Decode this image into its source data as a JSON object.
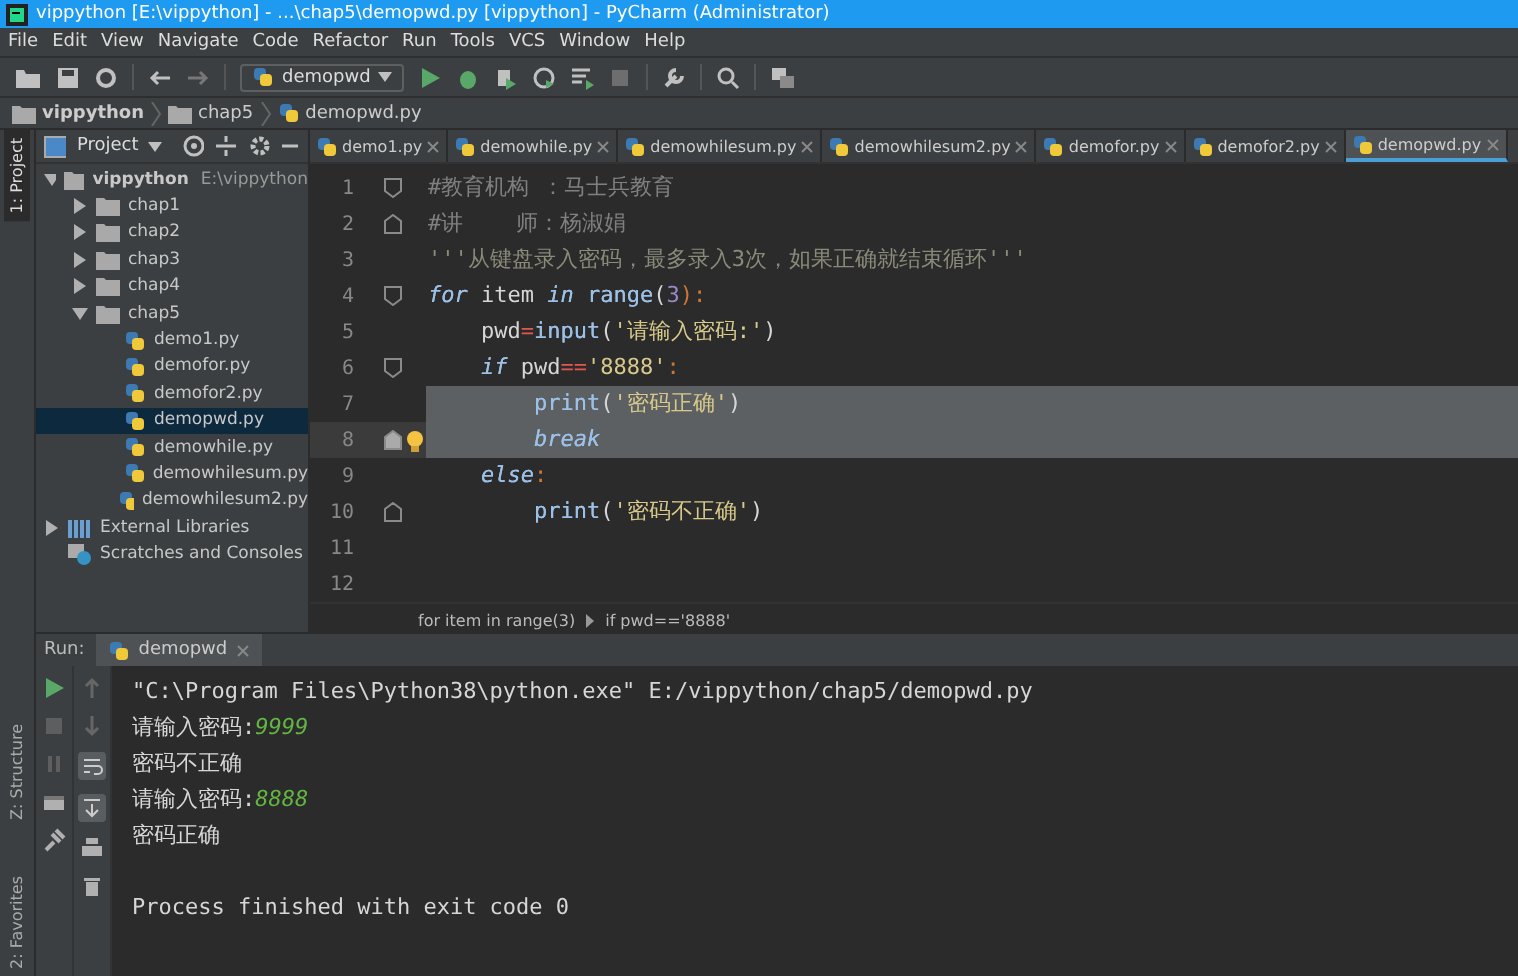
{
  "window": {
    "title": "vippython [E:\\vippython] - ...\\chap5\\demopwd.py [vippython] - PyCharm (Administrator)"
  },
  "menu": [
    "File",
    "Edit",
    "View",
    "Navigate",
    "Code",
    "Refactor",
    "Run",
    "Tools",
    "VCS",
    "Window",
    "Help"
  ],
  "toolbar": {
    "run_config": "demopwd"
  },
  "nav_bar": [
    "vippython",
    "chap5",
    "demopwd.py"
  ],
  "side_stripe": {
    "top": [
      {
        "label": "1: Project",
        "selected": true
      }
    ],
    "bottom": [
      {
        "label": "Z: Structure",
        "selected": false
      },
      {
        "label": "2: Favorites",
        "selected": false
      }
    ]
  },
  "project_panel": {
    "title": "Project",
    "tree": [
      {
        "label": "vippython",
        "path": "E:\\vippython",
        "kind": "root",
        "expanded": true,
        "selected": false,
        "children": [
          {
            "label": "chap1",
            "kind": "folder",
            "expanded": false,
            "selected": false
          },
          {
            "label": "chap2",
            "kind": "folder",
            "expanded": false,
            "selected": false
          },
          {
            "label": "chap3",
            "kind": "folder",
            "expanded": false,
            "selected": false
          },
          {
            "label": "chap4",
            "kind": "folder",
            "expanded": false,
            "selected": false
          },
          {
            "label": "chap5",
            "kind": "folder",
            "expanded": true,
            "selected": false,
            "children": [
              {
                "label": "demo1.py",
                "kind": "file",
                "selected": false
              },
              {
                "label": "demofor.py",
                "kind": "file",
                "selected": false
              },
              {
                "label": "demofor2.py",
                "kind": "file",
                "selected": false
              },
              {
                "label": "demopwd.py",
                "kind": "file",
                "selected": true
              },
              {
                "label": "demowhile.py",
                "kind": "file",
                "selected": false
              },
              {
                "label": "demowhilesum.py",
                "kind": "file",
                "selected": false
              },
              {
                "label": "demowhilesum2.py",
                "kind": "file",
                "selected": false
              }
            ]
          }
        ]
      },
      {
        "label": "External Libraries",
        "kind": "library",
        "expanded": false,
        "selected": false
      },
      {
        "label": "Scratches and Consoles",
        "kind": "scratches",
        "selected": false
      }
    ]
  },
  "editor_tabs": [
    {
      "label": "demo1.py",
      "selected": false
    },
    {
      "label": "demowhile.py",
      "selected": false
    },
    {
      "label": "demowhilesum.py",
      "selected": false
    },
    {
      "label": "demowhilesum2.py",
      "selected": false
    },
    {
      "label": "demofor.py",
      "selected": false
    },
    {
      "label": "demofor2.py",
      "selected": false
    },
    {
      "label": "demopwd.py",
      "selected": true
    }
  ],
  "code_lines": [
    {
      "number": "1",
      "fold_start": true,
      "fold_end": false,
      "selected": false,
      "current": false,
      "bulb": false,
      "tokens": [
        {
          "text": "#教育机构 ：马士兵教育",
          "kind": "comment"
        }
      ]
    },
    {
      "number": "2",
      "fold_start": false,
      "fold_end": true,
      "selected": false,
      "current": false,
      "bulb": false,
      "tokens": [
        {
          "text": "#讲    师：杨淑娟",
          "kind": "comment"
        }
      ]
    },
    {
      "number": "3",
      "fold_start": false,
      "fold_end": false,
      "selected": false,
      "current": false,
      "bulb": false,
      "tokens": [
        {
          "text": "'''从键盘录入密码，最多录入3次，如果正确就结束循环'''",
          "kind": "doc"
        }
      ]
    },
    {
      "number": "4",
      "fold_start": true,
      "fold_end": false,
      "selected": false,
      "current": false,
      "bulb": false,
      "tokens": [
        {
          "text": "for",
          "kind": "kw"
        },
        {
          "text": " item ",
          "kind": "text"
        },
        {
          "text": "in",
          "kind": "kw"
        },
        {
          "text": " range",
          "kind": "builtin"
        },
        {
          "text": "(",
          "kind": "text"
        },
        {
          "text": "3",
          "kind": "num"
        },
        {
          "text": "):",
          "kind": "punct"
        }
      ]
    },
    {
      "number": "5",
      "fold_start": false,
      "fold_end": false,
      "selected": false,
      "current": false,
      "bulb": false,
      "tokens": [
        {
          "text": "    pwd",
          "kind": "text"
        },
        {
          "text": "=",
          "kind": "op"
        },
        {
          "text": "input",
          "kind": "builtin"
        },
        {
          "text": "(",
          "kind": "text"
        },
        {
          "text": "'请输入密码:'",
          "kind": "str"
        },
        {
          "text": ")",
          "kind": "text"
        }
      ]
    },
    {
      "number": "6",
      "fold_start": true,
      "fold_end": false,
      "selected": false,
      "current": false,
      "bulb": false,
      "tokens": [
        {
          "text": "    if",
          "kind": "kw"
        },
        {
          "text": " pwd",
          "kind": "text"
        },
        {
          "text": "==",
          "kind": "op"
        },
        {
          "text": "'8888'",
          "kind": "str"
        },
        {
          "text": ":",
          "kind": "punct"
        }
      ]
    },
    {
      "number": "7",
      "fold_start": false,
      "fold_end": false,
      "selected": true,
      "current": false,
      "bulb": false,
      "tokens": [
        {
          "text": "        print",
          "kind": "builtin"
        },
        {
          "text": "(",
          "kind": "text"
        },
        {
          "text": "'密码正确'",
          "kind": "str"
        },
        {
          "text": ")",
          "kind": "text"
        }
      ]
    },
    {
      "number": "8",
      "fold_start": false,
      "fold_end": true,
      "selected": true,
      "current": true,
      "bulb": true,
      "tokens": [
        {
          "text": "        break",
          "kind": "kw"
        }
      ]
    },
    {
      "number": "9",
      "fold_start": false,
      "fold_end": false,
      "selected": false,
      "current": false,
      "bulb": false,
      "tokens": [
        {
          "text": "    else",
          "kind": "kw"
        },
        {
          "text": ":",
          "kind": "punct"
        }
      ]
    },
    {
      "number": "10",
      "fold_start": false,
      "fold_end": true,
      "selected": false,
      "current": false,
      "bulb": false,
      "tokens": [
        {
          "text": "        print",
          "kind": "builtin"
        },
        {
          "text": "(",
          "kind": "text"
        },
        {
          "text": "'密码不正确'",
          "kind": "str"
        },
        {
          "text": ")",
          "kind": "text"
        }
      ]
    },
    {
      "number": "11",
      "fold_start": false,
      "fold_end": false,
      "selected": false,
      "current": false,
      "bulb": false
    },
    {
      "number": "12",
      "fold_start": false,
      "fold_end": false,
      "selected": false,
      "current": false,
      "bulb": false
    }
  ],
  "breadcrumb": [
    "for item in range(3)",
    "if pwd=='8888'"
  ],
  "run_panel": {
    "label": "Run:",
    "tab": "demopwd",
    "lines": [
      {
        "kind": "io",
        "parts": [
          {
            "text": "\"C:\\Program Files\\Python38\\python.exe\" E:/vippython/chap5/demopwd.py",
            "kind": "output"
          }
        ]
      },
      {
        "kind": "io",
        "parts": [
          {
            "text": "请输入密码:",
            "kind": "output"
          },
          {
            "text": "9999",
            "kind": "input"
          }
        ]
      },
      {
        "kind": "io",
        "parts": [
          {
            "text": "密码不正确",
            "kind": "output"
          }
        ]
      },
      {
        "kind": "io",
        "parts": [
          {
            "text": "请输入密码:",
            "kind": "output"
          },
          {
            "text": "8888",
            "kind": "input"
          }
        ]
      },
      {
        "kind": "io",
        "parts": [
          {
            "text": "密码正确",
            "kind": "output"
          }
        ]
      },
      {
        "kind": "exit_status",
        "parts": [
          {
            "text": "Process finished with exit code 0",
            "kind": "output"
          }
        ]
      }
    ]
  }
}
